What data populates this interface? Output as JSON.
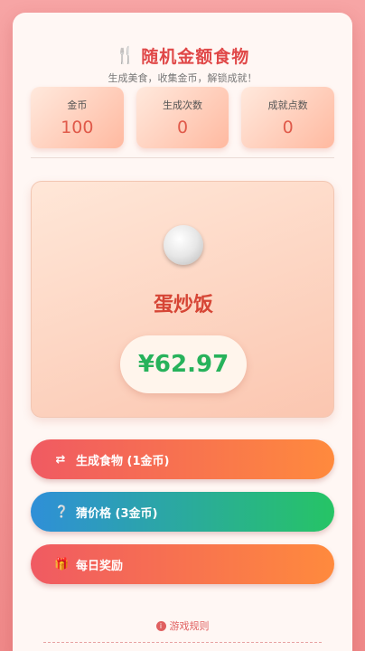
{
  "header": {
    "title": "随机金额食物",
    "subtitle": "生成美食，收集金币，解锁成就！",
    "icon": "utensils-icon"
  },
  "stats": [
    {
      "label": "金币",
      "value": "100"
    },
    {
      "label": "生成次数",
      "value": "0"
    },
    {
      "label": "成就点数",
      "value": "0"
    }
  ],
  "food": {
    "icon": "rice-bowl-icon",
    "name": "蛋炒饭",
    "price": "¥62.97"
  },
  "buttons": {
    "generate": {
      "label": "生成食物 (1金币)",
      "icon": "shuffle-icon"
    },
    "guess": {
      "label": "猜价格 (3金币)",
      "icon": "question-circle-icon"
    },
    "daily": {
      "label": "每日奖励",
      "icon": "gift-icon"
    }
  },
  "rules": {
    "label": "游戏规则",
    "icon": "info-circle-icon"
  },
  "colors": {
    "accent": "#e04848",
    "price": "#27b25b",
    "button_warm_start": "#f05a62",
    "button_warm_end": "#ff8a3d",
    "button_cool_start": "#2f8fd8",
    "button_cool_end": "#26c465"
  }
}
